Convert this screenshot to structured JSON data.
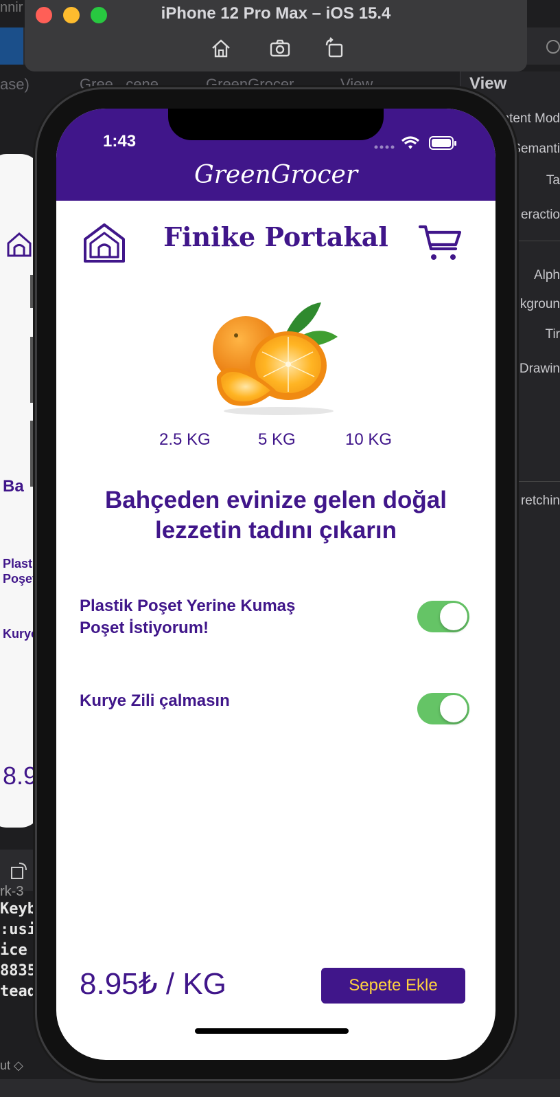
{
  "simulator": {
    "title": "iPhone 12 Pro Max – iOS 15.4",
    "tools": [
      "home-icon",
      "screenshot-icon",
      "rotate-icon"
    ]
  },
  "xcode": {
    "breadcrumb": [
      "ase)",
      "Gree...cene",
      "GreenGrocer",
      "View"
    ],
    "inspector_title": "View",
    "inspector_items": [
      "ntent Mod",
      "Semanti",
      "Ta",
      "eractio",
      "Alph",
      "kgroun",
      "Tir",
      "Drawin",
      "retchin"
    ],
    "top_left_fragment": "nnir",
    "console_lines": [
      "Keyb",
      ":usi",
      "ice",
      "8835",
      "tead"
    ],
    "bottom_left": "rk-3",
    "bottom_hint": "ut ◇"
  },
  "back_phone": {
    "ba": "Ba",
    "plasti": "Plasti",
    "poset": "Poşet",
    "kurye": "Kurye",
    "price": "8.9"
  },
  "status": {
    "time": "1:43"
  },
  "nav": {
    "title": "GreenGrocer"
  },
  "product": {
    "title": "Finike Portakal",
    "weights": [
      "2.5 KG",
      "5 KG",
      "10 KG"
    ],
    "headline": "Bahçeden evinize gelen doğal lezzetin tadını çıkarın",
    "options": [
      {
        "label": "Plastik Poşet Yerine Kumaş Poşet İstiyorum!",
        "on": true
      },
      {
        "label": "Kurye Zili çalmasın",
        "on": true
      }
    ],
    "price": "8.95₺ / KG",
    "add_to_cart": "Sepete Ekle"
  },
  "colors": {
    "brand": "#40168a",
    "button_text": "#ffd23f",
    "toggle_on": "#65c466"
  }
}
